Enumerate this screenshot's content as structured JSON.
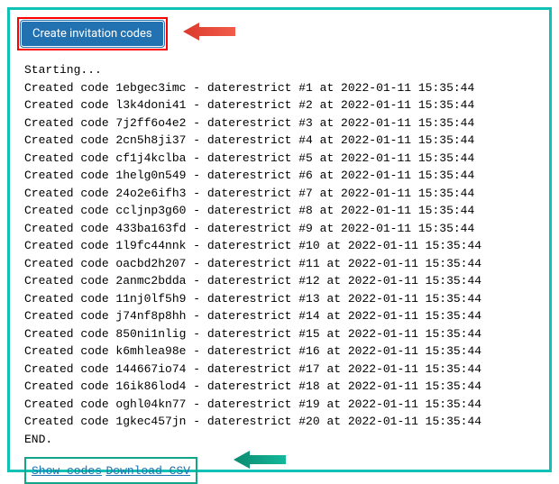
{
  "button_label": "Create invitation codes",
  "log": {
    "start": "Starting...",
    "end": "END.",
    "entries": [
      {
        "code": "1ebgec3imc",
        "label": "daterestrict",
        "n": 1,
        "ts": "2022-01-11 15:35:44"
      },
      {
        "code": "l3k4doni41",
        "label": "daterestrict",
        "n": 2,
        "ts": "2022-01-11 15:35:44"
      },
      {
        "code": "7j2ff6o4e2",
        "label": "daterestrict",
        "n": 3,
        "ts": "2022-01-11 15:35:44"
      },
      {
        "code": "2cn5h8ji37",
        "label": "daterestrict",
        "n": 4,
        "ts": "2022-01-11 15:35:44"
      },
      {
        "code": "cf1j4kclba",
        "label": "daterestrict",
        "n": 5,
        "ts": "2022-01-11 15:35:44"
      },
      {
        "code": "1helg0n549",
        "label": "daterestrict",
        "n": 6,
        "ts": "2022-01-11 15:35:44"
      },
      {
        "code": "24o2e6ifh3",
        "label": "daterestrict",
        "n": 7,
        "ts": "2022-01-11 15:35:44"
      },
      {
        "code": "ccljnp3g60",
        "label": "daterestrict",
        "n": 8,
        "ts": "2022-01-11 15:35:44"
      },
      {
        "code": "433ba163fd",
        "label": "daterestrict",
        "n": 9,
        "ts": "2022-01-11 15:35:44"
      },
      {
        "code": "1l9fc44nnk",
        "label": "daterestrict",
        "n": 10,
        "ts": "2022-01-11 15:35:44"
      },
      {
        "code": "oacbd2h207",
        "label": "daterestrict",
        "n": 11,
        "ts": "2022-01-11 15:35:44"
      },
      {
        "code": "2anmc2bdda",
        "label": "daterestrict",
        "n": 12,
        "ts": "2022-01-11 15:35:44"
      },
      {
        "code": "11nj0lf5h9",
        "label": "daterestrict",
        "n": 13,
        "ts": "2022-01-11 15:35:44"
      },
      {
        "code": "j74nf8p8hh",
        "label": "daterestrict",
        "n": 14,
        "ts": "2022-01-11 15:35:44"
      },
      {
        "code": "850ni1nlig",
        "label": "daterestrict",
        "n": 15,
        "ts": "2022-01-11 15:35:44"
      },
      {
        "code": "k6mhlea98e",
        "label": "daterestrict",
        "n": 16,
        "ts": "2022-01-11 15:35:44"
      },
      {
        "code": "144667io74",
        "label": "daterestrict",
        "n": 17,
        "ts": "2022-01-11 15:35:44"
      },
      {
        "code": "16ik86lod4",
        "label": "daterestrict",
        "n": 18,
        "ts": "2022-01-11 15:35:44"
      },
      {
        "code": "oghl04kn77",
        "label": "daterestrict",
        "n": 19,
        "ts": "2022-01-11 15:35:44"
      },
      {
        "code": "1gkec457jn",
        "label": "daterestrict",
        "n": 20,
        "ts": "2022-01-11 15:35:44"
      }
    ]
  },
  "links": {
    "show_codes": "Show codes",
    "download_csv": "Download CSV"
  }
}
